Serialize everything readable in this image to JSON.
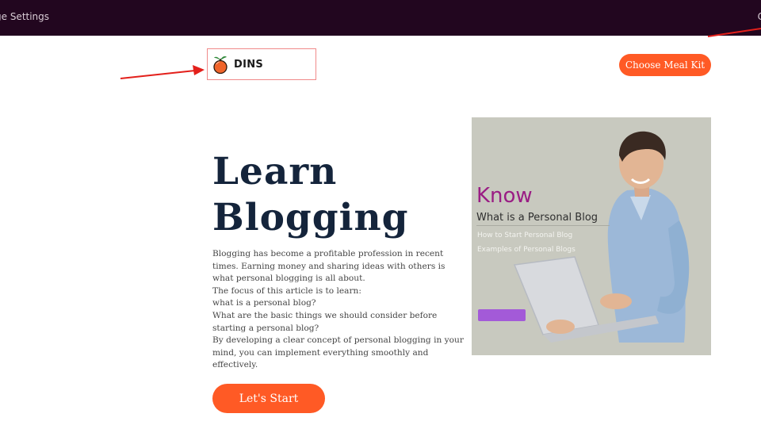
{
  "topbar": {
    "left_text": "ge Settings",
    "right_text": "C"
  },
  "header": {
    "logo_text": "DINS",
    "cta_label": "Choose Meal Kit"
  },
  "hero": {
    "title_line1": "Learn",
    "title_line2": "Blogging",
    "body_lines": [
      "Blogging has become a profitable profession in recent",
      "times. Earning money and sharing ideas with others is",
      "what personal blogging is all about.",
      "The focus of this article is to learn:",
      "what is a personal blog?",
      "What are the basic things we should consider before",
      "starting a personal blog?",
      "By developing a clear concept of personal blogging in your",
      "mind, you can implement everything smoothly and",
      "effectively."
    ],
    "button_label": "Let's Start"
  },
  "hero_image": {
    "heading": "Know",
    "subheading": "What is a Personal Blog",
    "line1": "How to Start Personal Blog",
    "line2": "Examples of Personal Blogs"
  },
  "colors": {
    "accent": "#ff5a25",
    "topbar": "#22061f",
    "title": "#14243b",
    "annotation_arrow": "#e3201b"
  },
  "icons": {
    "logo": "fruit-icon",
    "annotation": "red-arrow-icon"
  }
}
